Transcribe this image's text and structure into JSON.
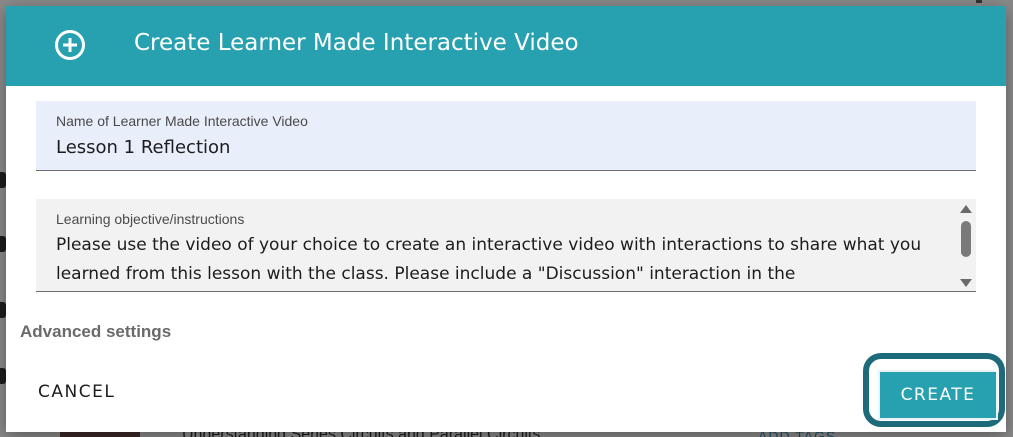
{
  "dialog": {
    "title": "Create Learner Made Interactive Video",
    "header_icon": "plus-circle-icon",
    "accent_color": "#27a0b0"
  },
  "name_field": {
    "label": "Name of Learner Made Interactive Video",
    "value": "Lesson 1 Reflection"
  },
  "objective_field": {
    "label": "Learning objective/instructions",
    "value": "Please use the video of your choice to create an interactive video with interactions to share what you learned from this lesson with the class. Please include a \"Discussion\" interaction in the"
  },
  "advanced_settings_label": "Advanced settings",
  "actions": {
    "cancel_label": "CANCEL",
    "create_label": "CREATE"
  },
  "background": {
    "row_title": "Understanding Series Circuits and Parallel Circuits",
    "add_tags_label": "ADD TAGS"
  }
}
